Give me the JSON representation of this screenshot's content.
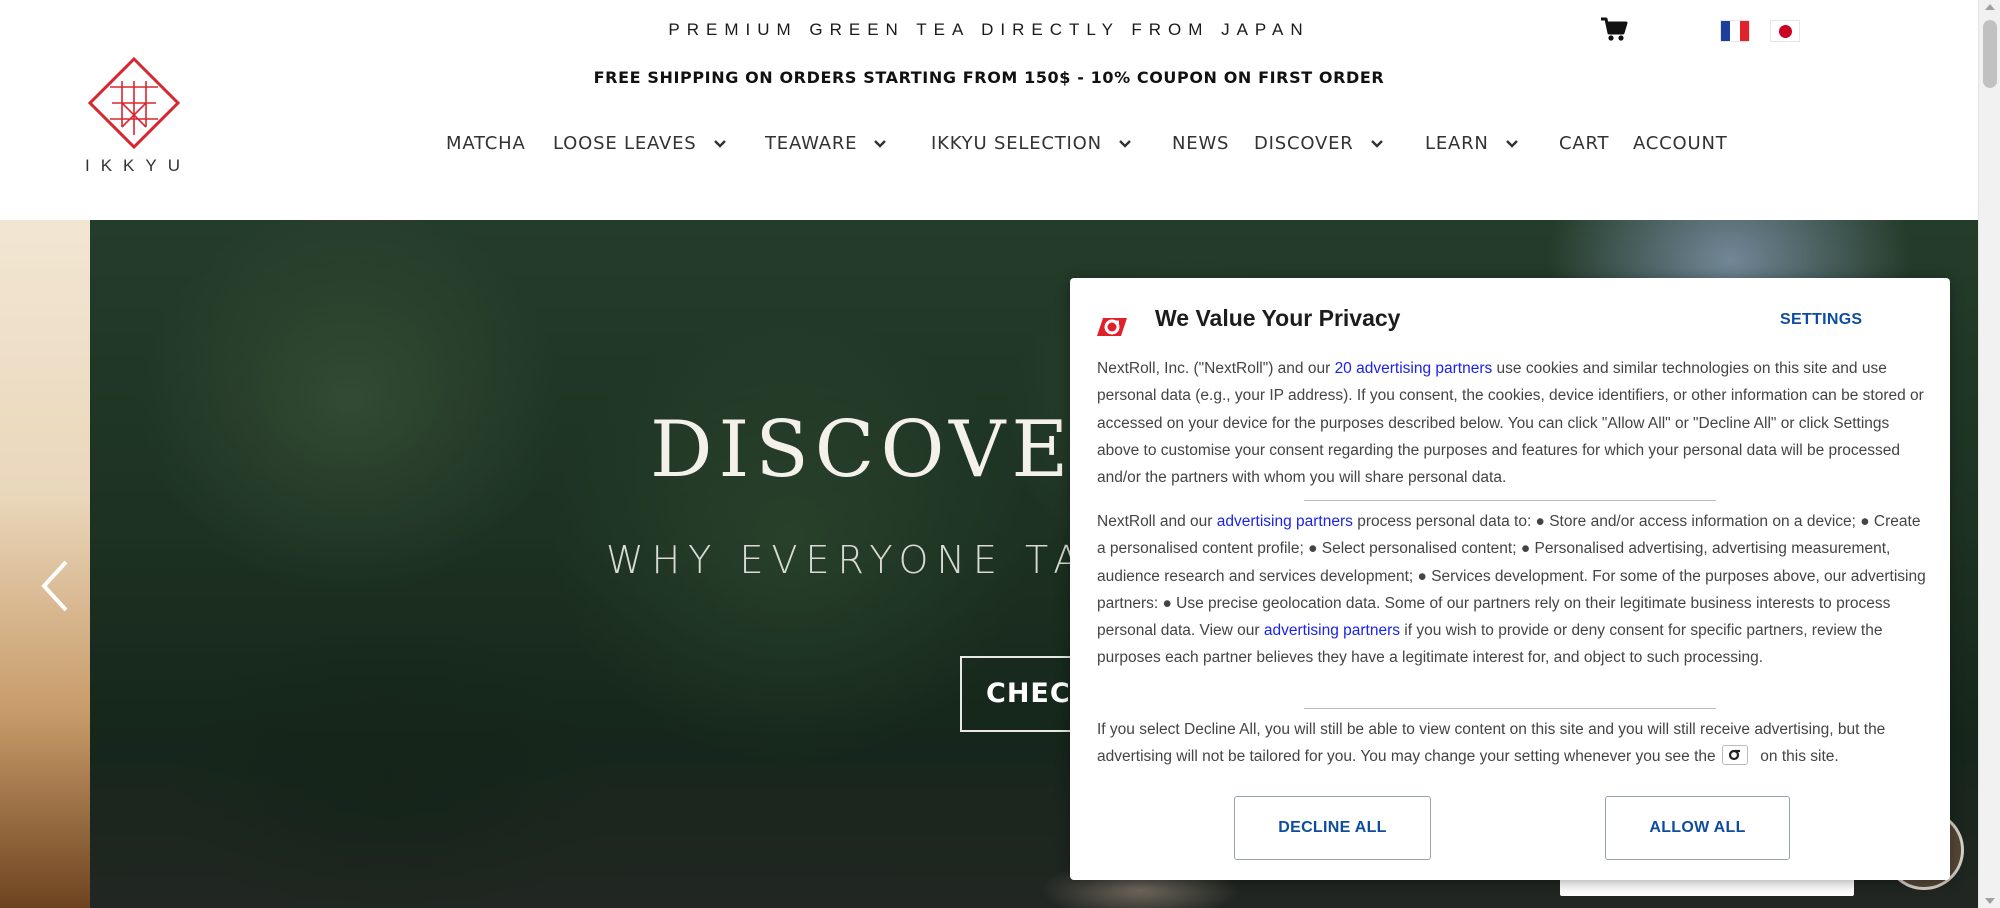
{
  "header": {
    "tagline": "PREMIUM GREEN TEA DIRECTLY FROM JAPAN",
    "shipping_banner": "FREE SHIPPING ON ORDERS STARTING FROM 150$ - 10% COUPON ON FIRST ORDER",
    "logo_text": "IKKYU",
    "cart_icon": "cart-icon",
    "languages": [
      "fr",
      "jp"
    ]
  },
  "nav": {
    "items": [
      {
        "label": "MATCHA",
        "dropdown": false
      },
      {
        "label": "LOOSE LEAVES",
        "dropdown": true
      },
      {
        "label": "TEAWARE",
        "dropdown": true
      },
      {
        "label": "IKKYU SELECTION",
        "dropdown": true
      },
      {
        "label": "NEWS",
        "dropdown": false
      },
      {
        "label": "DISCOVER",
        "dropdown": true
      },
      {
        "label": "LEARN",
        "dropdown": true
      },
      {
        "label": "CART",
        "dropdown": false
      },
      {
        "label": "ACCOUNT",
        "dropdown": false
      }
    ]
  },
  "hero": {
    "title": "DISCOVER",
    "subtitle": "WHY EVERYONE TA",
    "button_label": "CHECK"
  },
  "consent": {
    "title": "We Value Your Privacy",
    "settings_label": "SETTINGS",
    "p1": {
      "before_link": "NextRoll, Inc. (\"NextRoll\") and our ",
      "link": "20 advertising partners",
      "after_link": " use cookies and similar technologies on this site and use personal data (e.g., your IP address). If you consent, the cookies, device identifiers, or other information can be stored or accessed on your device for the purposes described below. You can click \"Allow All\" or \"Decline All\" or click Settings above to customise your consent regarding the purposes and features for which your personal data will be processed and/or the partners with whom you will share personal data."
    },
    "p2": {
      "before_link": "NextRoll and our ",
      "link": "advertising partners",
      "middle": " process personal data to: ● Store and/or access information on a device; ● Create a personalised content profile; ● Select personalised content; ● Personalised advertising, advertising measurement, audience research and services development; ● Services development. For some of the purposes above, our advertising partners: ● Use precise geolocation data. Some of our partners rely on their legitimate business interests to process personal data. View our ",
      "link2": "advertising partners",
      "after_link": " if you wish to provide or deny consent for specific partners, review the purposes each partner believes they have a legitimate interest for, and object to such processing."
    },
    "p3": {
      "before_icon": "If you select Decline All, you will still be able to view content on this site and you will still receive advertising, but the advertising will not be tailored for you. You may change your setting whenever you see the ",
      "after_icon": " on this site."
    },
    "decline_label": "DECLINE ALL",
    "allow_label": "ALLOW ALL"
  },
  "colors": {
    "brand_red": "#d9262e",
    "consent_link": "#1a23e6",
    "consent_button_text": "#0e4c9f"
  }
}
